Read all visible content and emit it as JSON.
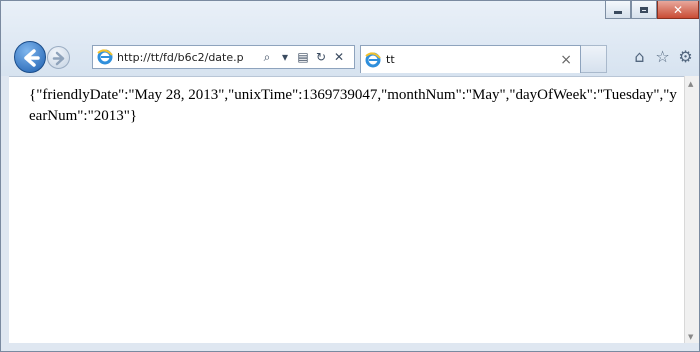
{
  "browser": {
    "address": "http://tt/fd/b6c2/date.p",
    "tab_title": "tt",
    "tab_close": "×"
  },
  "toolbar": {
    "search_glyph": "⌕",
    "dropdown_glyph": "▾",
    "compat_glyph": "▤",
    "refresh_glyph": "↻",
    "stop_glyph": "✕"
  },
  "page": {
    "json_text": "{\"friendlyDate\":\"May 28, 2013\",\"unixTime\":1369739047,\"monthNum\":\"May\",\"dayOfWeek\":\"Tuesday\",\"yearNum\":\"2013\"}"
  },
  "icons": {
    "home": "⌂",
    "favorites": "☆",
    "tools": "⚙"
  }
}
